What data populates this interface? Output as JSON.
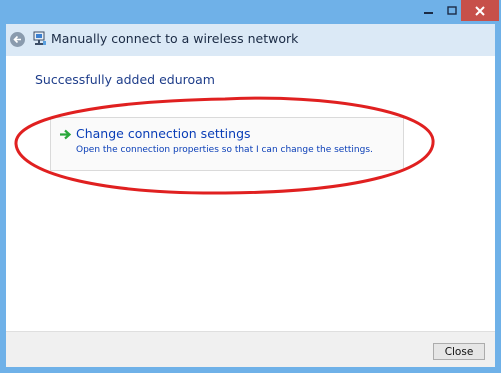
{
  "titlebar": {
    "minimize_glyph": "—",
    "close_glyph": "✕"
  },
  "header": {
    "back_icon": "back-arrow-icon",
    "network_icon": "network-icon",
    "title": "Manually connect to a wireless network"
  },
  "content": {
    "success_text": "Successfully added eduroam",
    "option": {
      "icon": "green-arrow-icon",
      "title": "Change connection settings",
      "description": "Open the connection properties so that I can change the settings."
    }
  },
  "footer": {
    "close_label": "Close"
  },
  "colors": {
    "window_frame": "#6fb1e8",
    "close_button": "#c7504a",
    "link_blue": "#0a3eb7",
    "highlight_ellipse": "#e02020"
  }
}
